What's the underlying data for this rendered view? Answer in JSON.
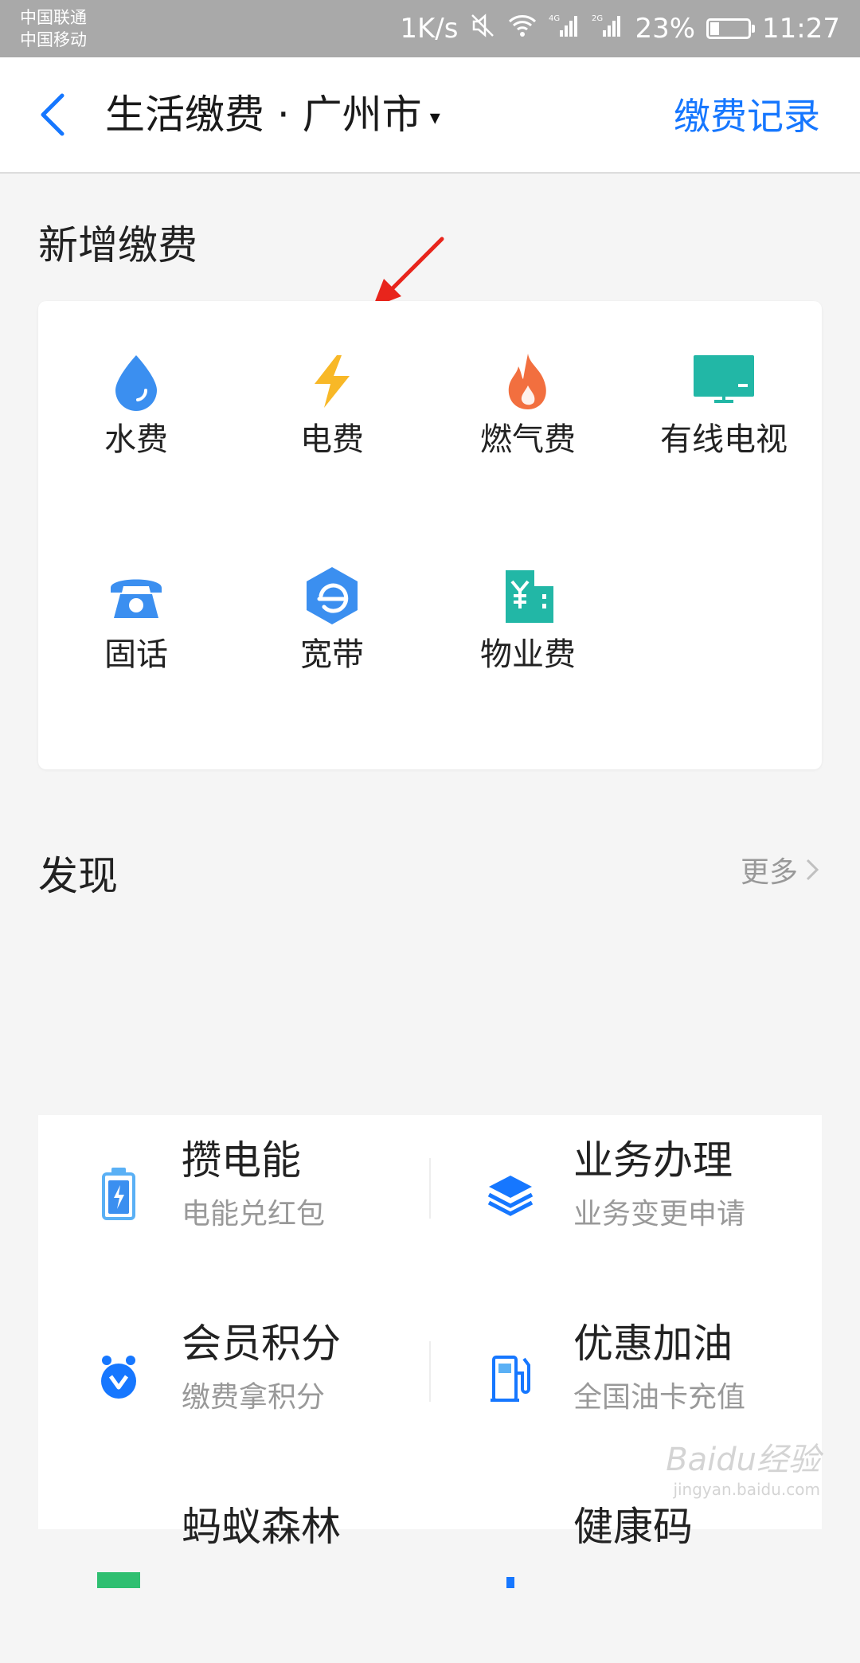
{
  "status_bar": {
    "carrier_1": "中国联通",
    "carrier_2": "中国移动",
    "speed": "1K/s",
    "net_1": "4G",
    "net_2": "2G",
    "battery": "23%",
    "battery_level": 0.23,
    "time": "11:27"
  },
  "nav": {
    "title": "生活缴费 · 广州市",
    "caret": "▾",
    "record": "缴费记录"
  },
  "new_payment": {
    "title": "新增缴费",
    "items": [
      {
        "label": "水费",
        "icon": "water-drop-icon",
        "color": "#3b8ff0"
      },
      {
        "label": "电费",
        "icon": "lightning-icon",
        "color": "#f8b827"
      },
      {
        "label": "燃气费",
        "icon": "flame-icon",
        "color": "#f26f3f"
      },
      {
        "label": "有线电视",
        "icon": "tv-icon",
        "color": "#22b7a6"
      },
      {
        "label": "固话",
        "icon": "telephone-icon",
        "color": "#3b8ff0"
      },
      {
        "label": "宽带",
        "icon": "broadband-icon",
        "color": "#3b8ff0"
      },
      {
        "label": "物业费",
        "icon": "property-building-icon",
        "color": "#22b7a6"
      }
    ]
  },
  "discover": {
    "title": "发现",
    "more": "更多",
    "items": [
      {
        "title": "攒电能",
        "subtitle": "电能兑红包",
        "icon": "battery-icon"
      },
      {
        "title": "业务办理",
        "subtitle": "业务变更申请",
        "icon": "layers-icon"
      },
      {
        "title": "会员积分",
        "subtitle": "缴费拿积分",
        "icon": "member-points-icon"
      },
      {
        "title": "优惠加油",
        "subtitle": "全国油卡充值",
        "icon": "fuel-pump-icon"
      },
      {
        "title": "蚂蚁森林",
        "subtitle": "",
        "icon": "forest-icon"
      },
      {
        "title": "健康码",
        "subtitle": "",
        "icon": "health-code-icon"
      }
    ]
  },
  "watermark": {
    "text": "Baidu经验",
    "sub": "jingyan.baidu.com"
  },
  "colors": {
    "accent": "#1677ff",
    "annotation_arrow": "#e8251c"
  }
}
